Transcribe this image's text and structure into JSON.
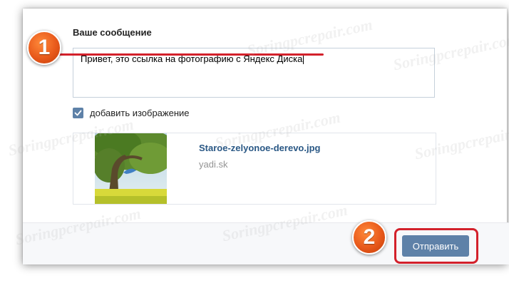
{
  "form": {
    "label": "Ваше сообщение",
    "message_value": "Привет, это ссылка на фотографию с Яндекс Диска",
    "checkbox_checked": true,
    "checkbox_label": "добавить изображение"
  },
  "attachment": {
    "file_name": "Staroe-zelyonoe-derevo.jpg",
    "domain": "yadi.sk"
  },
  "footer": {
    "send_label": "Отправить"
  },
  "markers": {
    "step1": "1",
    "step2": "2"
  },
  "watermark": "Soringpcrepair.com",
  "colors": {
    "accent": "#5e81a8",
    "link": "#2a5885",
    "highlight": "#d3212b",
    "marker": "#e8591b"
  }
}
